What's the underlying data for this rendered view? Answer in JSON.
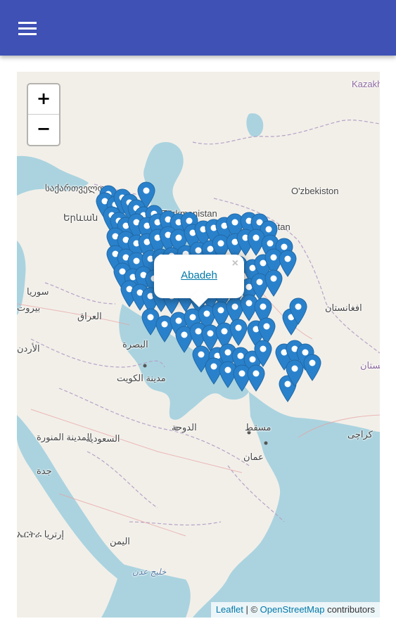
{
  "app": {
    "menu_icon": "hamburger-menu-icon",
    "primary_color": "#3f51b5"
  },
  "map": {
    "zoom_in_label": "+",
    "zoom_out_label": "−",
    "popup": {
      "link_text": "Abadeh",
      "close_label": "×"
    },
    "attribution": {
      "leaflet": "Leaflet",
      "separator": " | © ",
      "osm": "OpenStreetMap",
      "suffix": " contributors"
    },
    "marker_color": "#2a81cb",
    "labels": {
      "kazakh": "Kazakh",
      "georgia": "საქართველო",
      "yerevan": "Երևան",
      "uzbekiston": "O'zbekiston",
      "turkmenistan": "Türkmenistan",
      "turkmenistan_full": "Türkmenistan",
      "syria": "سوريا",
      "beirut": "بيروت",
      "iraq": "العراق",
      "jordan": "الأردن",
      "basra": "البصرة",
      "kuwait": "مدينة الكويت",
      "afghanistan": "افغانستان",
      "pakistan": "پاکستان",
      "madinah": "المدينة المنورة",
      "saudi": "السعودية",
      "jeddah": "جدة",
      "doha": "الدوحة",
      "muscat": "مسقط",
      "oman": "عمان",
      "karachi": "کراچی",
      "eritrea": "ኤርትራ إرتريا",
      "yemen": "اليمن",
      "aden": "خليج عدن"
    }
  }
}
